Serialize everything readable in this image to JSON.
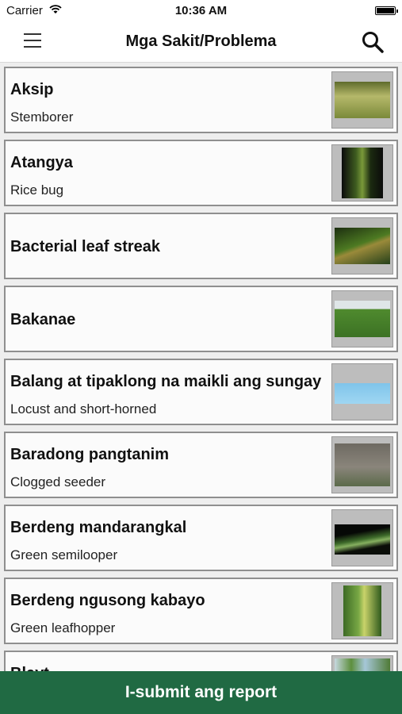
{
  "status_bar": {
    "carrier": "Carrier",
    "time": "10:36 AM"
  },
  "header": {
    "title": "Mga Sakit/Problema",
    "menu_icon": "hamburger-menu-icon",
    "search_icon": "search-icon"
  },
  "items": [
    {
      "name": "Aksip",
      "subtitle": "Stemborer"
    },
    {
      "name": "Atangya",
      "subtitle": "Rice bug"
    },
    {
      "name": "Bacterial leaf streak",
      "subtitle": ""
    },
    {
      "name": "Bakanae",
      "subtitle": ""
    },
    {
      "name": "Balang at tipaklong na maikli ang sungay",
      "subtitle": "Locust and short-horned"
    },
    {
      "name": "Baradong pangtanim",
      "subtitle": "Clogged seeder"
    },
    {
      "name": "Berdeng mandarangkal",
      "subtitle": "Green semilooper"
    },
    {
      "name": "Berdeng ngusong kabayo",
      "subtitle": "Green leafhopper"
    },
    {
      "name": "Blayt",
      "subtitle": ""
    }
  ],
  "footer": {
    "submit_label": "I-submit ang report",
    "color": "#206a43"
  }
}
